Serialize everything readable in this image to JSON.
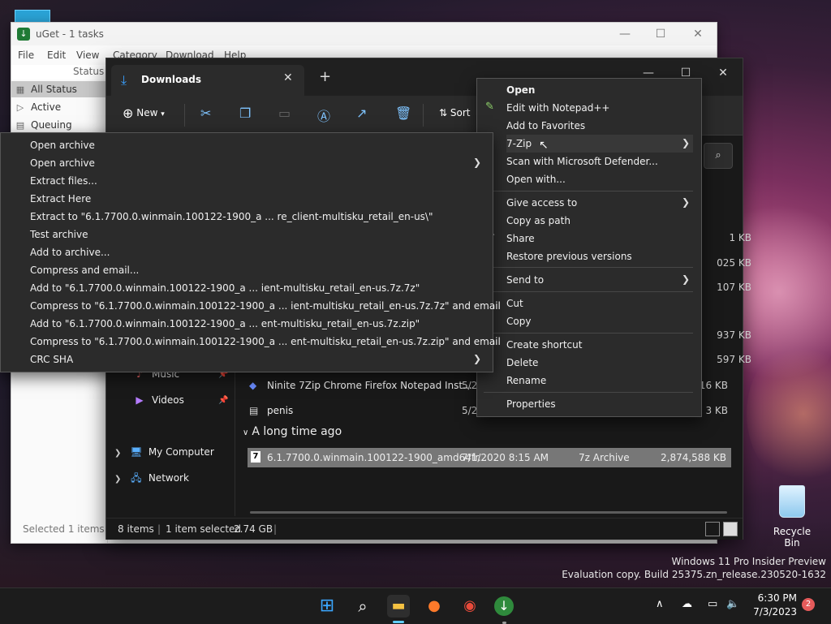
{
  "uget": {
    "title": "uGet - 1 tasks",
    "menu": [
      "File",
      "Edit",
      "View",
      "Category",
      "Download",
      "Help"
    ],
    "status_header": "Status",
    "sidebar": [
      {
        "label": "All Status",
        "selected": true
      },
      {
        "label": "Active"
      },
      {
        "label": "Queuing"
      }
    ],
    "footer": "Selected 1 items"
  },
  "explorer": {
    "tab_title": "Downloads",
    "toolbar": {
      "new_label": "New",
      "sort_label": "Sort"
    },
    "nav": [
      {
        "label": "Music",
        "icon": "music-icon"
      },
      {
        "label": "Videos",
        "icon": "videos-icon"
      },
      {
        "label": "My Computer",
        "icon": "computer-icon"
      },
      {
        "label": "Network",
        "icon": "network-icon"
      }
    ],
    "partial_sizes": [
      "1 KB",
      "025 KB",
      "107 KB",
      "937 KB",
      "597 KB"
    ],
    "rows": [
      {
        "name": "Ninite 7Zip Chrome Firefox Notepad Inst...",
        "date": "5/2",
        "size": "416 KB"
      },
      {
        "name": "penis",
        "date": "5/2",
        "size": "3 KB"
      }
    ],
    "group": "A long time ago",
    "selected_row": {
      "name": "6.1.7700.0.winmain.100122-1900_amd64fr...",
      "date": "7/1/2020 8:15 AM",
      "type": "7z Archive",
      "size": "2,874,588 KB"
    },
    "status": {
      "items": "8 items",
      "selected": "1 item selected",
      "size": "2.74 GB"
    }
  },
  "context_menu": {
    "groups": [
      [
        {
          "label": "Open",
          "bold": true
        },
        {
          "label": "Edit with Notepad++",
          "icon": "notepadpp-icon"
        },
        {
          "label": "Add to Favorites"
        },
        {
          "label": "7-Zip",
          "submenu": true
        },
        {
          "label": "Scan with Microsoft Defender...",
          "icon": "defender-icon"
        },
        {
          "label": "Open with..."
        }
      ],
      [
        {
          "label": "Give access to",
          "submenu": true
        },
        {
          "label": "Copy as path"
        },
        {
          "label": "Share",
          "icon": "share-icon"
        },
        {
          "label": "Restore previous versions"
        }
      ],
      [
        {
          "label": "Send to",
          "submenu": true
        }
      ],
      [
        {
          "label": "Cut"
        },
        {
          "label": "Copy"
        }
      ],
      [
        {
          "label": "Create shortcut"
        },
        {
          "label": "Delete"
        },
        {
          "label": "Rename"
        }
      ],
      [
        {
          "label": "Properties"
        }
      ]
    ]
  },
  "zip_submenu": [
    {
      "label": "Open archive"
    },
    {
      "label": "Open archive",
      "submenu": true
    },
    {
      "label": "Extract files..."
    },
    {
      "label": "Extract Here"
    },
    {
      "label": "Extract to \"6.1.7700.0.winmain.100122-1900_a ... re_client-multisku_retail_en-us\\\""
    },
    {
      "label": "Test archive"
    },
    {
      "label": "Add to archive..."
    },
    {
      "label": "Compress and email..."
    },
    {
      "label": "Add to \"6.1.7700.0.winmain.100122-1900_a ... ient-multisku_retail_en-us.7z.7z\""
    },
    {
      "label": "Compress to \"6.1.7700.0.winmain.100122-1900_a ... ient-multisku_retail_en-us.7z.7z\" and email"
    },
    {
      "label": "Add to \"6.1.7700.0.winmain.100122-1900_a ... ent-multisku_retail_en-us.7z.zip\""
    },
    {
      "label": "Compress to \"6.1.7700.0.winmain.100122-1900_a ... ent-multisku_retail_en-us.7z.zip\" and email"
    },
    {
      "label": "CRC SHA",
      "submenu": true
    }
  ],
  "desktop": {
    "recycle_bin": "Recycle Bin",
    "watermark_line1": "Windows 11 Pro Insider Preview",
    "watermark_line2": "Evaluation copy. Build 25375.zn_release.230520-1632"
  },
  "taskbar": {
    "time": "6:30 PM",
    "date": "7/3/2023",
    "notifications": "2"
  }
}
